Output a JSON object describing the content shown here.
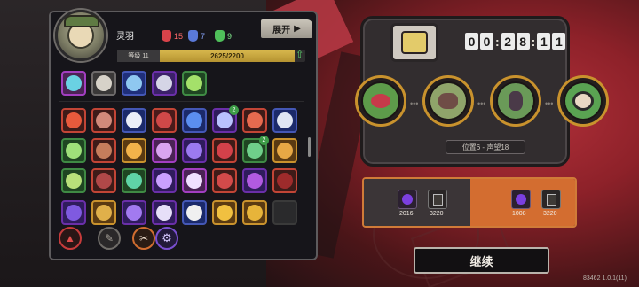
{
  "player": {
    "name": "灵羽",
    "stats": [
      {
        "icon": "red-unit-icon",
        "value": "15",
        "color": "#d9434a"
      },
      {
        "icon": "blue-unit-icon",
        "value": "7",
        "color": "#5a79d8"
      },
      {
        "icon": "green-unit-icon",
        "value": "9",
        "color": "#4fbf5a"
      }
    ],
    "level_label": "等级 11",
    "exp_text": "2625/2200",
    "exp_fraction": 1.0
  },
  "panel": {
    "expand_label": "展开"
  },
  "timer": {
    "digits": [
      "0",
      "0",
      "2",
      "8",
      "1",
      "1"
    ]
  },
  "position": {
    "label": "位置6 - 声望18"
  },
  "rewards": {
    "left": [
      {
        "icon": "purple-orb-icon",
        "value": "2016"
      },
      {
        "icon": "card-icon",
        "value": "3220"
      }
    ],
    "right": [
      {
        "icon": "purple-orb-icon",
        "value": "1008"
      },
      {
        "icon": "card-upgrade-icon",
        "value": "3220"
      }
    ]
  },
  "continue_label": "继续",
  "version": "83462 1.0.1(11)",
  "colors": {
    "accent": "#d36d30",
    "gold": "#c9922d",
    "panel_bg": "#16151a"
  }
}
